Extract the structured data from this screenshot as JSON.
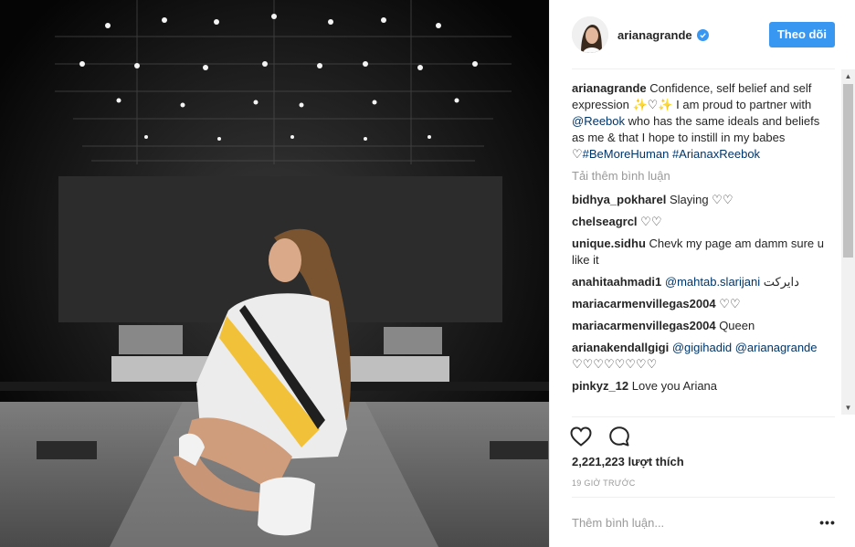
{
  "post": {
    "username": "arianagrande",
    "follow_label": "Theo dõi",
    "caption_user": "arianagrande",
    "caption_text_1": "Confidence, self belief and self expression ",
    "caption_emoji_1": "✨♡✨",
    "caption_text_2": " I am proud to partner with ",
    "caption_mention": "@Reebok",
    "caption_text_3": " who has the same ideals and beliefs as me & that I hope to instill in my babes ",
    "caption_emoji_2": "♡",
    "caption_tag_1": "#BeMoreHuman",
    "caption_tag_2": "#ArianaxReebok",
    "load_more_label": "Tải thêm bình luận"
  },
  "comments": [
    {
      "user": "bidhya_pokharel",
      "text": "Slaying ♡♡"
    },
    {
      "user": "chelseagrcl",
      "text": "♡♡"
    },
    {
      "user": "unique.sidhu",
      "text": "Chevk my page am damm sure u like it"
    },
    {
      "user": "anahitaahmadi1",
      "mention": "@mahtab.slarijani",
      "text": "دایرکت"
    },
    {
      "user": "mariacarmenvillegas2004",
      "text": "♡♡"
    },
    {
      "user": "mariacarmenvillegas2004",
      "text": "Queen"
    },
    {
      "user": "arianakendallgigi",
      "mention": "@gigihadid",
      "mention2": "@arianagrande",
      "text": "♡♡♡♡♡♡♡♡"
    },
    {
      "user": "pinkyz_12",
      "text": "Love you Ariana"
    }
  ],
  "actions": {
    "like_icon": "heart-outline-icon",
    "comment_icon": "speech-bubble-icon",
    "likes_text": "2,221,223 lượt thích",
    "time_text": "19 GIỜ TRƯỚC"
  },
  "add_comment": {
    "placeholder": "Thêm bình luận...",
    "more_label": "•••"
  },
  "colors": {
    "accent": "#3897f0",
    "link": "#003569",
    "muted": "#999999",
    "text": "#262626"
  }
}
